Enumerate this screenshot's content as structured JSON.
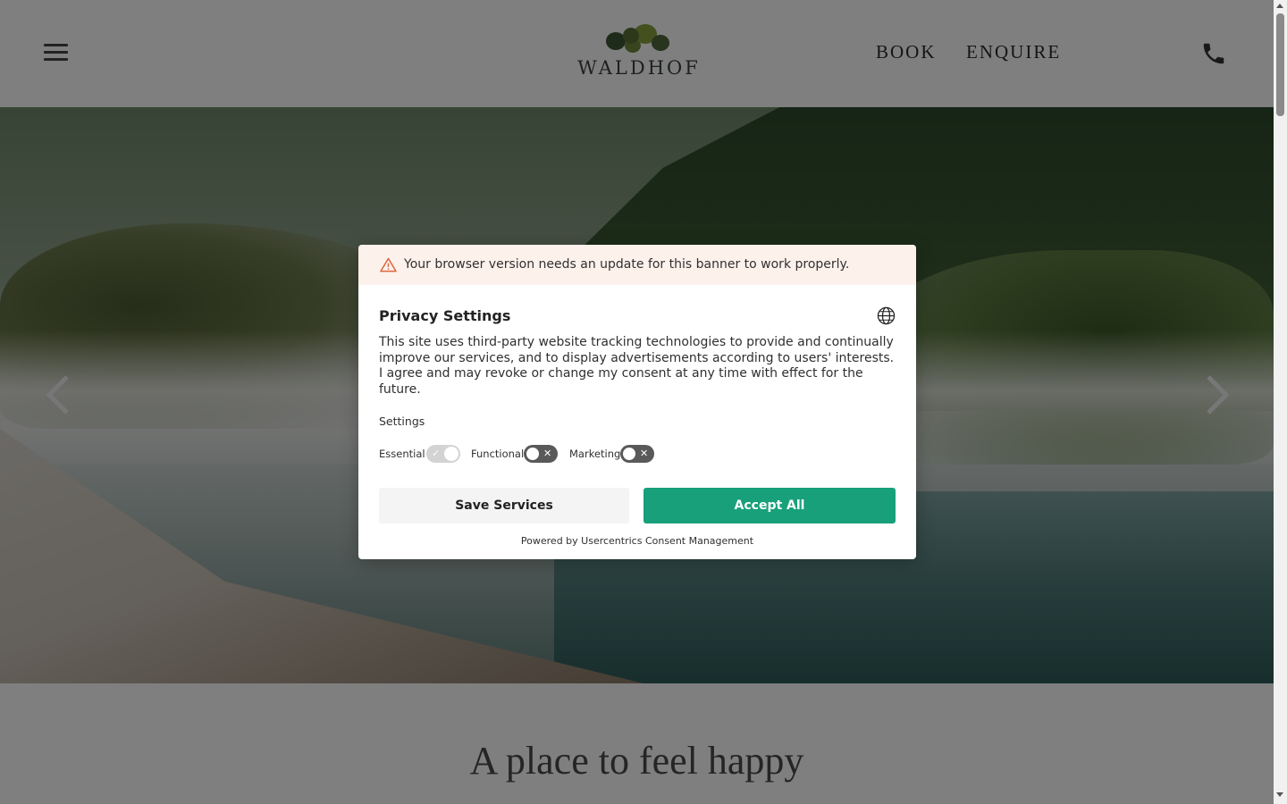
{
  "header": {
    "logo_text": "WALDHOF",
    "nav": {
      "book": "BOOK",
      "enquire": "ENQUIRE"
    }
  },
  "hero": {
    "prev_icon": "chevron-left-icon",
    "next_icon": "chevron-right-icon"
  },
  "main": {
    "tagline": "A place to feel happy"
  },
  "consent": {
    "warning": "Your browser version needs an update for this banner to work properly.",
    "title": "Privacy Settings",
    "description": "This site uses third-party website tracking technologies to provide and continually improve our services, and to display advertisements according to users' interests. I agree and may revoke or change my consent at any time with effect for the future.",
    "settings_label": "Settings",
    "toggles": [
      {
        "label": "Essential",
        "state": "on-disabled"
      },
      {
        "label": "Functional",
        "state": "off"
      },
      {
        "label": "Marketing",
        "state": "off"
      }
    ],
    "save_label": "Save Services",
    "accept_label": "Accept All",
    "powered_by": "Powered by Usercentrics Consent Management"
  },
  "colors": {
    "accent": "#18a07b",
    "warning_bg": "#fdf1ec",
    "warning_icon": "#e0653a",
    "overlay": "rgba(0,0,0,0.5)"
  }
}
